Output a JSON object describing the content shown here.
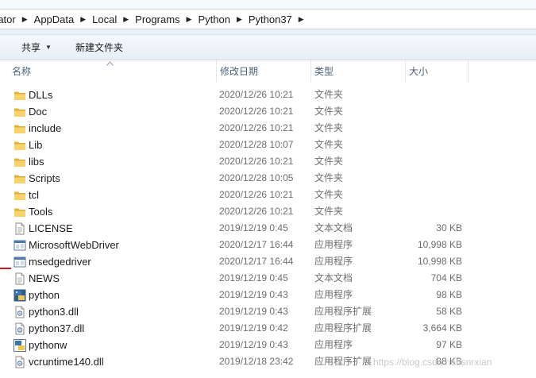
{
  "breadcrumbs": [
    "rator",
    "AppData",
    "Local",
    "Programs",
    "Python",
    "Python37"
  ],
  "toolbar": {
    "share_label": "共享",
    "new_folder_label": "新建文件夹"
  },
  "columns": {
    "name": "名称",
    "date": "修改日期",
    "type": "类型",
    "size": "大小"
  },
  "files": [
    {
      "name": "DLLs",
      "date": "2020/12/26 10:21",
      "type": "文件夹",
      "size": "",
      "icon": "folder-icon"
    },
    {
      "name": "Doc",
      "date": "2020/12/26 10:21",
      "type": "文件夹",
      "size": "",
      "icon": "folder-icon"
    },
    {
      "name": "include",
      "date": "2020/12/26 10:21",
      "type": "文件夹",
      "size": "",
      "icon": "folder-icon"
    },
    {
      "name": "Lib",
      "date": "2020/12/28 10:07",
      "type": "文件夹",
      "size": "",
      "icon": "folder-icon"
    },
    {
      "name": "libs",
      "date": "2020/12/26 10:21",
      "type": "文件夹",
      "size": "",
      "icon": "folder-icon"
    },
    {
      "name": "Scripts",
      "date": "2020/12/28 10:05",
      "type": "文件夹",
      "size": "",
      "icon": "folder-icon"
    },
    {
      "name": "tcl",
      "date": "2020/12/26 10:21",
      "type": "文件夹",
      "size": "",
      "icon": "folder-icon"
    },
    {
      "name": "Tools",
      "date": "2020/12/26 10:21",
      "type": "文件夹",
      "size": "",
      "icon": "folder-icon"
    },
    {
      "name": "LICENSE",
      "date": "2019/12/19 0:45",
      "type": "文本文档",
      "size": "30 KB",
      "icon": "text-file-icon"
    },
    {
      "name": "MicrosoftWebDriver",
      "date": "2020/12/17 16:44",
      "type": "应用程序",
      "size": "10,998 KB",
      "icon": "application-icon"
    },
    {
      "name": "msedgedriver",
      "date": "2020/12/17 16:44",
      "type": "应用程序",
      "size": "10,998 KB",
      "icon": "application-icon"
    },
    {
      "name": "NEWS",
      "date": "2019/12/19 0:45",
      "type": "文本文档",
      "size": "704 KB",
      "icon": "text-file-icon"
    },
    {
      "name": "python",
      "date": "2019/12/19 0:43",
      "type": "应用程序",
      "size": "98 KB",
      "icon": "python-icon"
    },
    {
      "name": "python3.dll",
      "date": "2019/12/19 0:43",
      "type": "应用程序扩展",
      "size": "58 KB",
      "icon": "dll-icon"
    },
    {
      "name": "python37.dll",
      "date": "2019/12/19 0:42",
      "type": "应用程序扩展",
      "size": "3,664 KB",
      "icon": "dll-icon"
    },
    {
      "name": "pythonw",
      "date": "2019/12/19 0:43",
      "type": "应用程序",
      "size": "97 KB",
      "icon": "pythonw-icon"
    },
    {
      "name": "vcruntime140.dll",
      "date": "2019/12/18 23:42",
      "type": "应用程序扩展",
      "size": "88 KB",
      "icon": "dll-icon"
    }
  ],
  "watermark": "https://blog.csdn.net/snrxian"
}
